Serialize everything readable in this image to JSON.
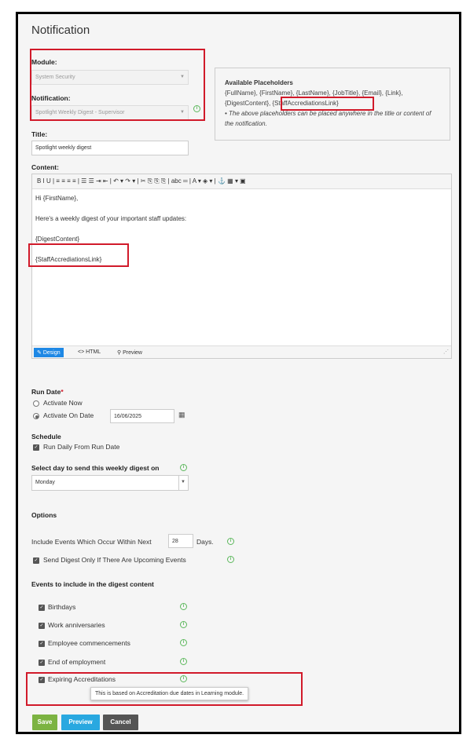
{
  "page_title": "Notification",
  "module": {
    "label": "Module:",
    "value": "System Security"
  },
  "notification": {
    "label": "Notification:",
    "value": "Spotlight Weekly Digest - Supervisor"
  },
  "title_field": {
    "label": "Title:",
    "value": "Spotlight weekly digest"
  },
  "placeholders": {
    "heading": "Available Placeholders",
    "line1": "{FullName}, {FirstName}, {LastName}, {JobTitle}, {Email}, {Link},",
    "line2_a": "{DigestContent}, ",
    "line2_b": "{StaffAccrediationsLink}",
    "note": "• The above placeholders can be placed anywhere in the title or content of the notification."
  },
  "content": {
    "label": "Content:",
    "toolbar": "B  I  U | ≡ ≡ ≡ ≡ | ☰ ☰ ⇥ ⇤ | ↶ ▾ ↷ ▾ | ✂ ⎘ ⎘ ⎘ | abc ═ | A ▾ ◈ ▾ | ⚓ ▦ ▾ ▣",
    "lines": [
      "Hi {FirstName},",
      "Here's a weekly digest of your important staff updates:",
      "{DigestContent}",
      "{StaffAccrediationsLink}"
    ],
    "tabs": {
      "design": "Design",
      "html": "HTML",
      "preview": "Preview"
    }
  },
  "run_date": {
    "label": "Run Date",
    "required": "*",
    "option_now": "Activate Now",
    "option_on": "Activate On Date",
    "date": "16/06/2025"
  },
  "schedule": {
    "label": "Schedule",
    "run_daily": "Run Daily From Run Date"
  },
  "weekly_day": {
    "label": "Select day to send this weekly digest on",
    "value": "Monday"
  },
  "options": {
    "label": "Options",
    "include_prefix": "Include Events Which Occur Within Next",
    "days_value": "28",
    "days_suffix": "Days.",
    "send_only": "Send Digest Only If There Are Upcoming Events"
  },
  "events": {
    "label": "Events to include in the digest content",
    "items": [
      "Birthdays",
      "Work anniversaries",
      "Employee commencements",
      "End of employment",
      "Expiring Accreditations"
    ],
    "tooltip": "This is based on Accreditation due dates in Learning module."
  },
  "buttons": {
    "save": "Save",
    "preview": "Preview",
    "cancel": "Cancel"
  },
  "colors": {
    "accent": "#1e88e5",
    "save": "#7cb342",
    "preview": "#29a8e0",
    "cancel": "#555555",
    "highlight": "#d11a2a",
    "info": "#5cb85c"
  }
}
